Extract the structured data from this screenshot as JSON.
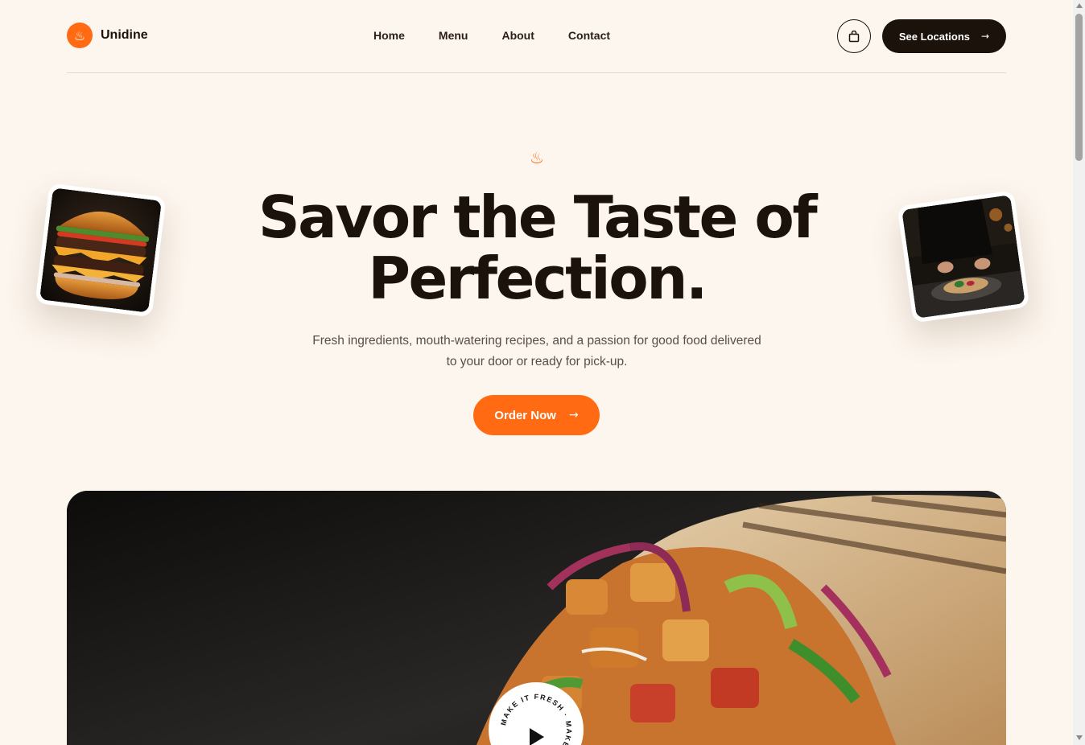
{
  "brand": {
    "name": "Unidine",
    "logo_icon": "steam-bowl-icon"
  },
  "nav": {
    "items": [
      "Home",
      "Menu",
      "About",
      "Contact"
    ]
  },
  "header": {
    "cart_icon": "shopping-bag-icon",
    "locations_label": "See Locations",
    "locations_arrow": "→"
  },
  "hero": {
    "icon": "steam-icon",
    "title_line1": "Savor the Taste of",
    "title_line2": "Perfection.",
    "subtitle": "Fresh ingredients, mouth-watering recipes, and a passion for good food delivered to your door or ready for pick-up.",
    "cta_label": "Order Now",
    "cta_arrow": "→"
  },
  "images": {
    "left_card": "burger-photo",
    "right_card": "chef-plating-wrap-photo",
    "feature": "grilled-wrap-photo"
  },
  "badge": {
    "circular_text": "MAKE IT FRESH · MAKE IT YOURS ·",
    "play_icon": "play-icon"
  },
  "colors": {
    "accent": "#ff6a13",
    "dark": "#1b120c",
    "background": "#fdf6ee"
  }
}
